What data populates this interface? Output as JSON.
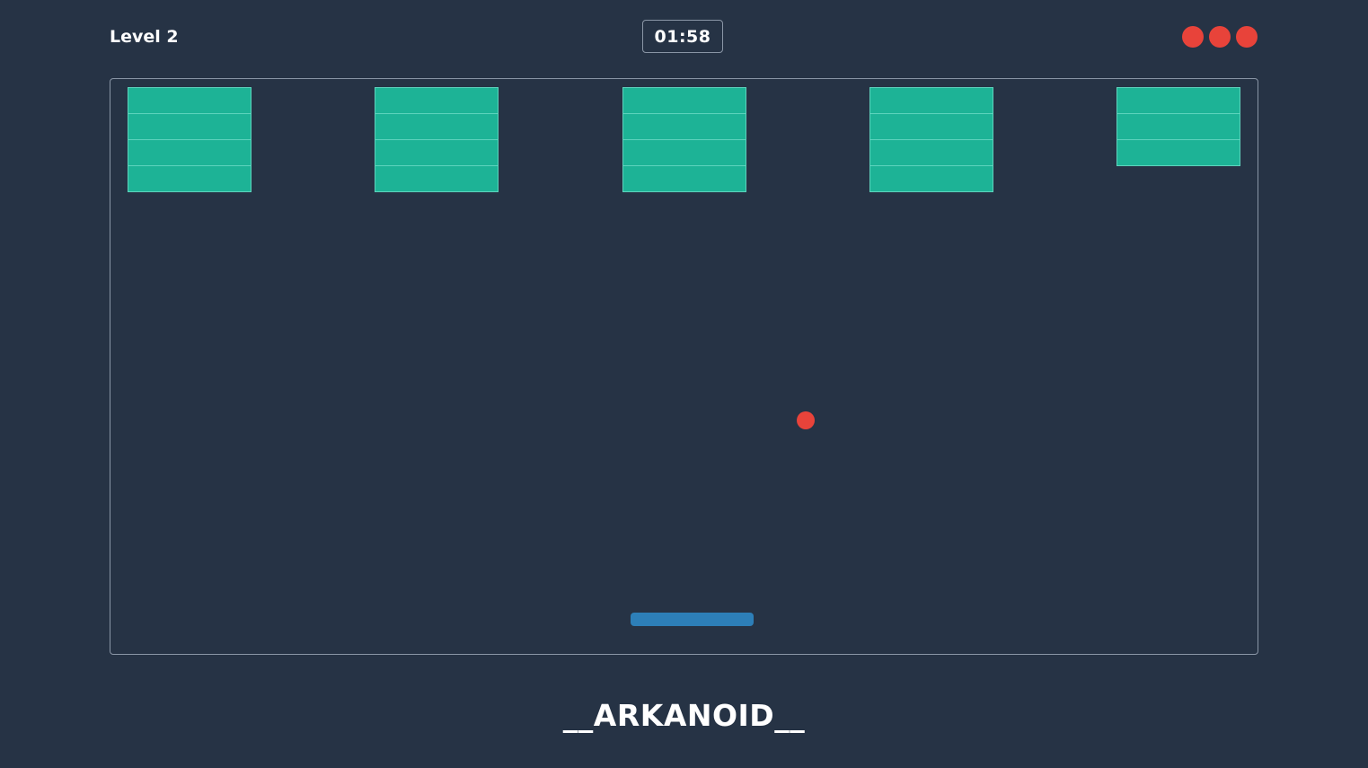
{
  "hud": {
    "level_label": "Level 2",
    "timer": "01:58",
    "lives_remaining": 3,
    "life_icon": "red-dot-icon"
  },
  "board": {
    "brick_columns": [
      {
        "bricks": 4
      },
      {
        "bricks": 4
      },
      {
        "bricks": 4
      },
      {
        "bricks": 4
      },
      {
        "bricks": 3
      }
    ]
  },
  "footer": {
    "title": "__ARKANOID__"
  },
  "colors": {
    "background": "#263345",
    "brick": "#1db396",
    "ball": "#e8433a",
    "paddle": "#2d7fb8",
    "life": "#e8433a",
    "border": "#8a96a6"
  }
}
